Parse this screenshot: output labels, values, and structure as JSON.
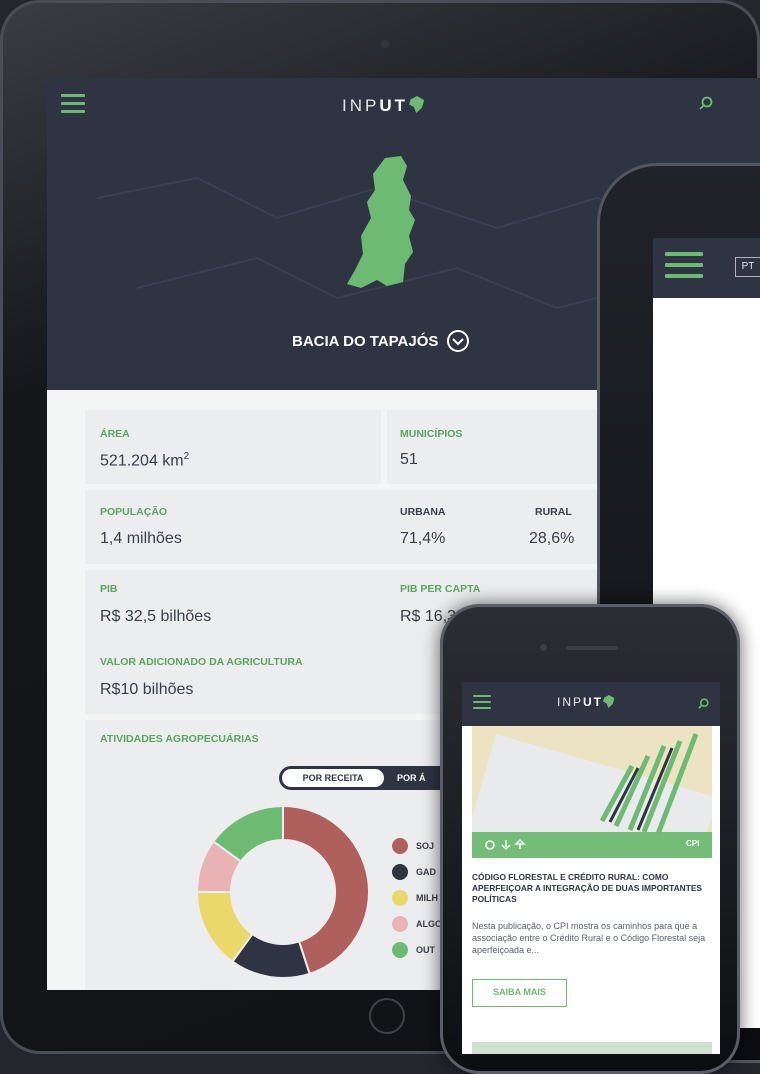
{
  "tablet": {
    "logo": {
      "pre": "INP",
      "bold": "UT"
    },
    "region": "BACIA DO TAPAJÓS",
    "stats": {
      "area_label": "ÁREA",
      "area_value": "521.204 km",
      "area_unit_sup": "2",
      "municipios_label": "MUNICÍPIOS",
      "municipios_value": "51",
      "populacao_label": "POPULAÇÃO",
      "populacao_value": "1,4 milhões",
      "urbana_label": "URBANA",
      "urbana_value": "71,4%",
      "rural_label": "RURAL",
      "rural_value": "28,6%",
      "pib_label": "PIB",
      "pib_value": "R$ 32,5 bilhões",
      "pib_capta_label": "PIB PER CAPTA",
      "pib_capta_value": "R$ 16,3",
      "agri_label": "VALOR ADICIONADO DA AGRICULTURA",
      "agri_value": "R$10 bilhões"
    },
    "activities_label": "ATIVIDADES AGROPECUÁRIAS",
    "toggle": {
      "active": "POR RECEITA",
      "inactive": "POR Á"
    },
    "legend": [
      {
        "label": "SOJ",
        "color": "#b0605c"
      },
      {
        "label": "GAD",
        "color": "#2f3443"
      },
      {
        "label": "MILH",
        "color": "#ead96a"
      },
      {
        "label": "ALGO",
        "color": "#e9b3b6"
      },
      {
        "label": "OUT",
        "color": "#6dbb73"
      }
    ]
  },
  "chart_data": {
    "type": "pie",
    "categories": [
      "SOJA",
      "GADO",
      "MILHO",
      "ALGODÃO",
      "OUTROS"
    ],
    "values": [
      45,
      15,
      15,
      10,
      15
    ]
  },
  "phone_large": {
    "lang_button": "PT"
  },
  "phone_small": {
    "logo": {
      "pre": "INP",
      "bold": "UT"
    },
    "card": {
      "tag": "CPI",
      "title": "CÓDIGO FLORESTAL E CRÉDITO RURAL: COMO APERFEIÇOAR A INTEGRAÇÃO DE DUAS IMPORTANTES POLÍTICAS",
      "description": "Nesta publicação, o CPI mostra os caminhos para que a associação entre o Crédito Rural e o Código Florestal seja aperfeiçoada e...",
      "button": "SAIBA MAIS"
    }
  }
}
